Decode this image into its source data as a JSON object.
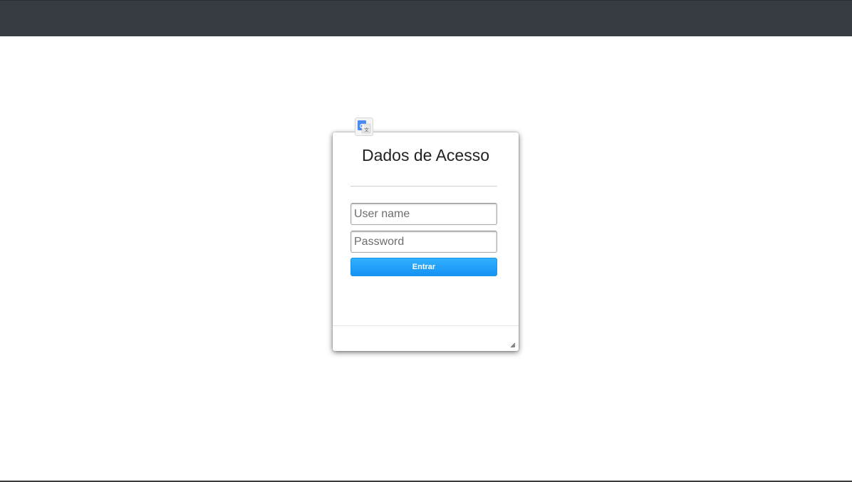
{
  "dialog": {
    "title": "Dados de Acesso",
    "username_placeholder": "User name",
    "username_value": "",
    "password_placeholder": "Password",
    "password_value": "",
    "submit_label": "Entrar"
  },
  "icons": {
    "translate": "google-translate-icon",
    "resize": "resize-grip-icon"
  },
  "colors": {
    "topbar": "#373c42",
    "accent": "#1e9bf7",
    "background": "#ffffff"
  }
}
